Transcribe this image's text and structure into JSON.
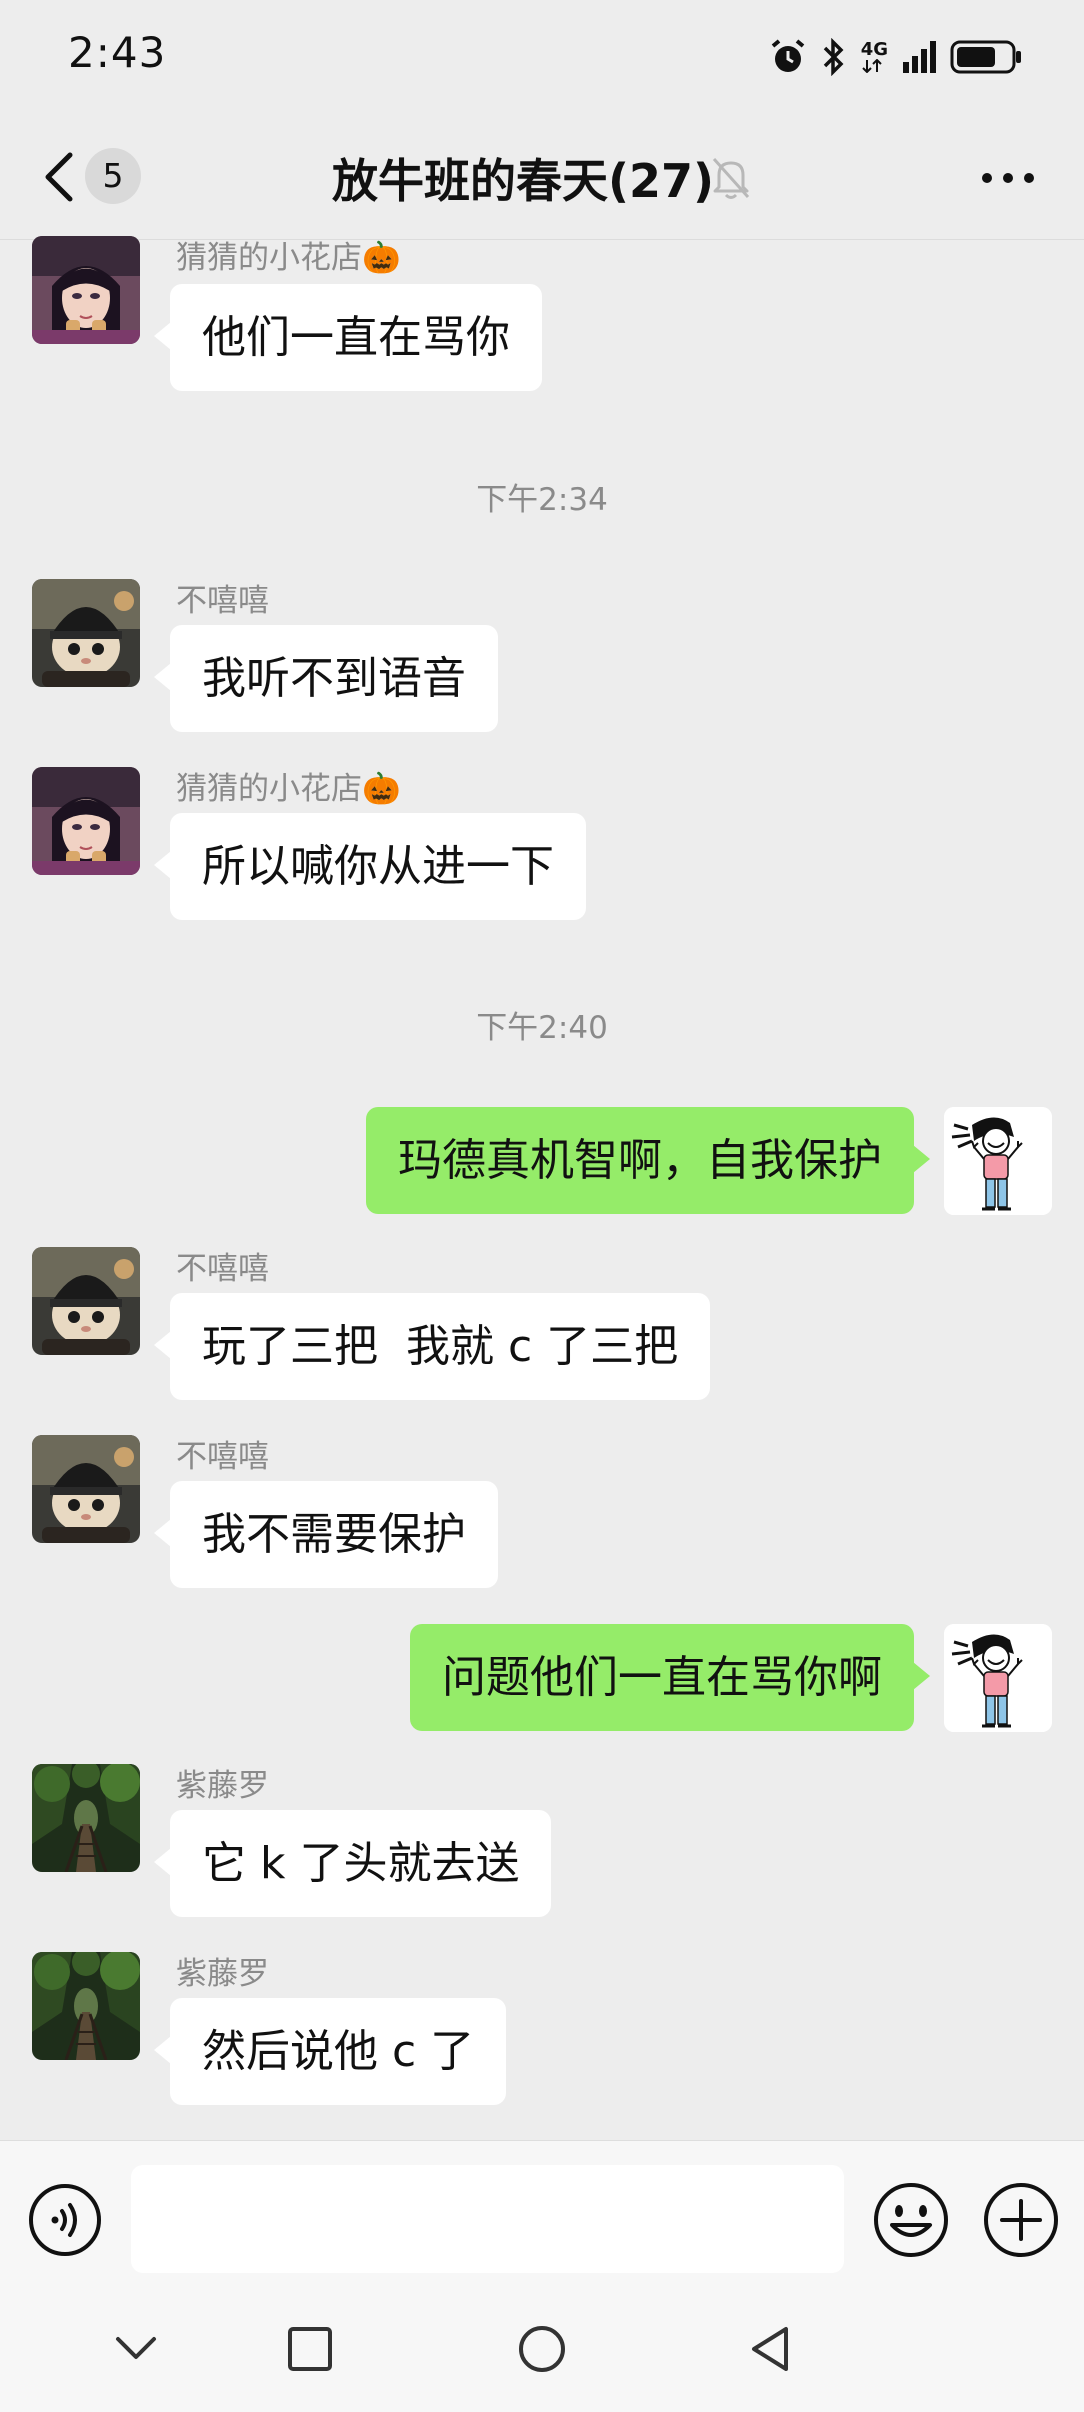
{
  "status_bar": {
    "time": "2:43",
    "network": "4G",
    "icons": [
      "alarm-icon",
      "bluetooth-icon",
      "network-4g-icon",
      "signal-icon",
      "battery-icon"
    ]
  },
  "header": {
    "unread_count": "5",
    "title": "放牛班的春天(27)",
    "icons": [
      "back-icon",
      "mute-bell-icon",
      "more-icon"
    ]
  },
  "messages": [
    {
      "side": "in",
      "sender": "猜猜的小花店🎃",
      "text": "他们一直在骂你",
      "avatar": "anime-girl"
    },
    {
      "timestamp": "下午2:34"
    },
    {
      "side": "in",
      "sender": "不嘻嘻",
      "text": "我听不到语音",
      "avatar": "cat-helmet"
    },
    {
      "side": "in",
      "sender": "猜猜的小花店🎃",
      "text": "所以喊你从进一下",
      "avatar": "anime-girl"
    },
    {
      "timestamp": "下午2:40"
    },
    {
      "side": "out",
      "text": "玛德真机智啊，自我保护",
      "avatar": "cartoon-person"
    },
    {
      "side": "in",
      "sender": "不嘻嘻",
      "text": "玩了三把  我就 c 了三把",
      "avatar": "cat-helmet"
    },
    {
      "side": "in",
      "sender": "不嘻嘻",
      "text": "我不需要保护",
      "avatar": "cat-helmet"
    },
    {
      "side": "out",
      "text": "问题他们一直在骂你啊",
      "avatar": "cartoon-person"
    },
    {
      "side": "in",
      "sender": "紫藤罗",
      "text": "它 k 了头就去送",
      "avatar": "forest-bridge"
    },
    {
      "side": "in",
      "sender": "紫藤罗",
      "text": "然后说他 c 了",
      "avatar": "forest-bridge"
    }
  ],
  "input_bar": {
    "placeholder": "",
    "icons": [
      "voice-icon",
      "emoji-icon",
      "plus-icon"
    ]
  },
  "nav_bar": {
    "icons": [
      "chevron-down-icon",
      "square-icon",
      "circle-icon",
      "triangle-back-icon"
    ]
  },
  "colors": {
    "background": "#ededed",
    "incoming_bubble": "#ffffff",
    "outgoing_bubble": "#95ec69",
    "meta_text": "#8a8a8a"
  }
}
